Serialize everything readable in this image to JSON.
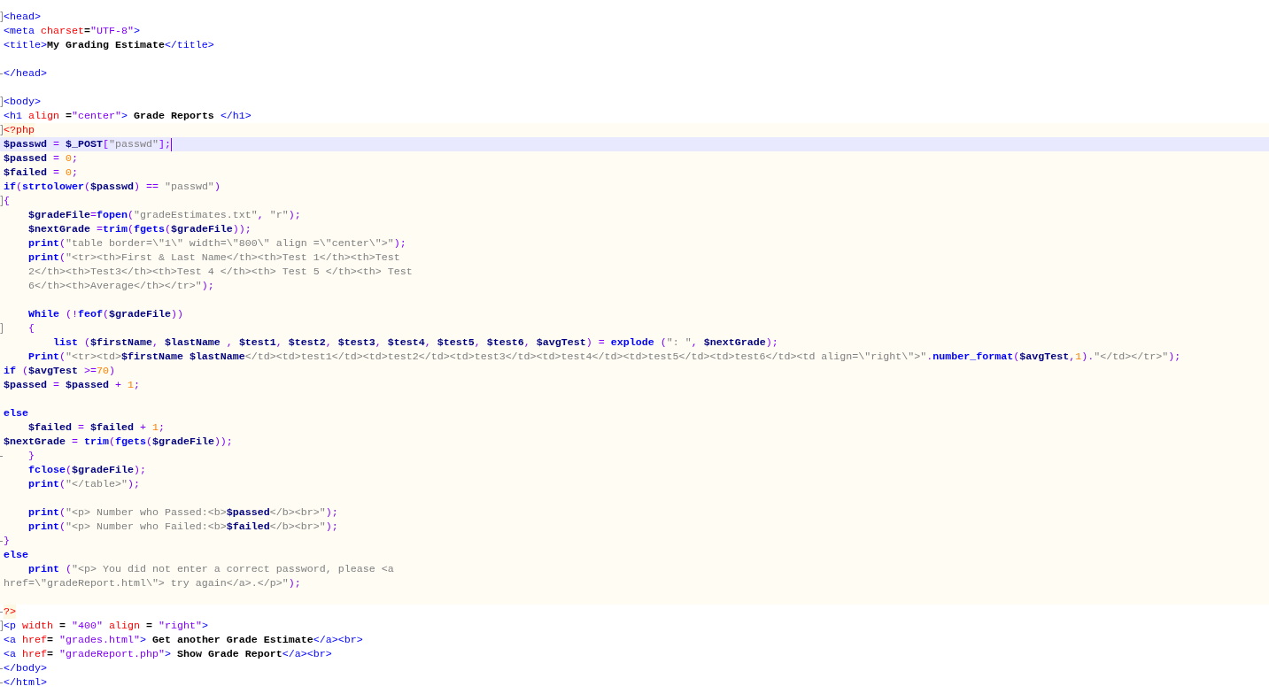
{
  "blocks": [
    {
      "kind": "html",
      "lines": [
        {
          "kind": "opener",
          "current": false,
          "tokens": [
            {
              "kind": "tag",
              "text": "<head>"
            }
          ]
        },
        {
          "kind": "plain",
          "current": false,
          "tokens": [
            {
              "kind": "tag",
              "text": "<meta "
            },
            {
              "kind": "attr",
              "text": "charset"
            },
            {
              "kind": "text",
              "text": "="
            },
            {
              "kind": "val",
              "text": "\"UTF-8\""
            },
            {
              "kind": "tag",
              "text": ">"
            }
          ]
        },
        {
          "kind": "plain",
          "current": false,
          "tokens": [
            {
              "kind": "tag",
              "text": "<title>"
            },
            {
              "kind": "text",
              "text": "My Grading Estimate"
            },
            {
              "kind": "tag",
              "text": "</title>"
            }
          ]
        },
        {
          "kind": "plain"
        },
        {
          "kind": "closer",
          "current": false,
          "tokens": [
            {
              "kind": "tag",
              "text": "</head>"
            }
          ]
        },
        {
          "kind": "plain"
        },
        {
          "kind": "opener",
          "current": false,
          "tokens": [
            {
              "kind": "tag",
              "text": "<body>"
            }
          ]
        },
        {
          "kind": "plain",
          "current": false,
          "tokens": [
            {
              "kind": "tag",
              "text": "<h1 "
            },
            {
              "kind": "attr",
              "text": "align"
            },
            {
              "kind": "text",
              "text": " ="
            },
            {
              "kind": "val",
              "text": "\"center\""
            },
            {
              "kind": "tag",
              "text": ">"
            },
            {
              "kind": "text",
              "text": " Grade Reports "
            },
            {
              "kind": "tag",
              "text": "</h1>"
            }
          ]
        }
      ]
    },
    {
      "kind": "php",
      "lines": [
        {
          "kind": "opener",
          "current": false,
          "tokens": [
            {
              "kind": "delim",
              "text": "<?php"
            }
          ]
        },
        {
          "kind": "plain",
          "current": true,
          "tokens": [
            {
              "kind": "var",
              "text": "$passwd"
            },
            {
              "kind": "op",
              "text": " = "
            },
            {
              "kind": "var",
              "text": "$_POST"
            },
            {
              "kind": "op",
              "text": "["
            },
            {
              "kind": "str",
              "text": "\"passwd\""
            },
            {
              "kind": "op",
              "text": "];"
            }
          ]
        },
        {
          "kind": "plain",
          "current": false,
          "tokens": [
            {
              "kind": "var",
              "text": "$passed"
            },
            {
              "kind": "op",
              "text": " = "
            },
            {
              "kind": "num",
              "text": "0"
            },
            {
              "kind": "op",
              "text": ";"
            }
          ]
        },
        {
          "kind": "plain",
          "current": false,
          "tokens": [
            {
              "kind": "var",
              "text": "$failed"
            },
            {
              "kind": "op",
              "text": " = "
            },
            {
              "kind": "num",
              "text": "0"
            },
            {
              "kind": "op",
              "text": ";"
            }
          ]
        },
        {
          "kind": "plain",
          "current": false,
          "tokens": [
            {
              "kind": "kw",
              "text": "if"
            },
            {
              "kind": "op",
              "text": "("
            },
            {
              "kind": "kw",
              "text": "strtolower"
            },
            {
              "kind": "op",
              "text": "("
            },
            {
              "kind": "var",
              "text": "$passwd"
            },
            {
              "kind": "op",
              "text": ") == "
            },
            {
              "kind": "str",
              "text": "\"passwd\""
            },
            {
              "kind": "op",
              "text": ")"
            }
          ]
        },
        {
          "kind": "opener",
          "current": false,
          "tokens": [
            {
              "kind": "op",
              "text": "{"
            }
          ]
        },
        {
          "kind": "plain",
          "current": false,
          "tokens": [
            {
              "kind": "var",
              "text": "    $gradeFile"
            },
            {
              "kind": "op",
              "text": "="
            },
            {
              "kind": "kw",
              "text": "fopen"
            },
            {
              "kind": "op",
              "text": "("
            },
            {
              "kind": "str",
              "text": "\"gradeEstimates.txt\""
            },
            {
              "kind": "op",
              "text": ", "
            },
            {
              "kind": "str",
              "text": "\"r\""
            },
            {
              "kind": "op",
              "text": ");"
            }
          ]
        },
        {
          "kind": "plain",
          "current": false,
          "tokens": [
            {
              "kind": "var",
              "text": "    $nextGrade"
            },
            {
              "kind": "op",
              "text": " ="
            },
            {
              "kind": "kw",
              "text": "trim"
            },
            {
              "kind": "op",
              "text": "("
            },
            {
              "kind": "kw",
              "text": "fgets"
            },
            {
              "kind": "op",
              "text": "("
            },
            {
              "kind": "var",
              "text": "$gradeFile"
            },
            {
              "kind": "op",
              "text": "));"
            }
          ]
        },
        {
          "kind": "plain",
          "current": false,
          "tokens": [
            {
              "kind": "kw",
              "text": "    print"
            },
            {
              "kind": "op",
              "text": "("
            },
            {
              "kind": "str",
              "text": "\"table border=\\\"1\\\" width=\\\"800\\\" align =\\\"center\\\">\""
            },
            {
              "kind": "op",
              "text": ");"
            }
          ]
        },
        {
          "kind": "plain",
          "current": false,
          "tokens": [
            {
              "kind": "kw",
              "text": "    print"
            },
            {
              "kind": "op",
              "text": "("
            },
            {
              "kind": "str",
              "text": "\"<tr><th>First & Last Name</th><th>Test 1</th><th>Test"
            }
          ]
        },
        {
          "kind": "plain",
          "current": false,
          "tokens": [
            {
              "kind": "str",
              "text": "    2</th><th>Test3</th><th>Test 4 </th><th> Test 5 </th><th> Test"
            }
          ]
        },
        {
          "kind": "plain",
          "current": false,
          "tokens": [
            {
              "kind": "str",
              "text": "    6</th><th>Average</th></tr>\""
            },
            {
              "kind": "op",
              "text": ");"
            }
          ]
        },
        {
          "kind": "plain"
        },
        {
          "kind": "plain",
          "current": false,
          "tokens": [
            {
              "kind": "kw",
              "text": "    While"
            },
            {
              "kind": "op",
              "text": " (!"
            },
            {
              "kind": "kw",
              "text": "feof"
            },
            {
              "kind": "op",
              "text": "("
            },
            {
              "kind": "var",
              "text": "$gradeFile"
            },
            {
              "kind": "op",
              "text": "))"
            }
          ]
        },
        {
          "kind": "opener",
          "current": false,
          "tokens": [
            {
              "kind": "op",
              "text": "    {"
            }
          ]
        },
        {
          "kind": "plain",
          "current": false,
          "tokens": [
            {
              "kind": "kw",
              "text": "        list"
            },
            {
              "kind": "op",
              "text": " ("
            },
            {
              "kind": "var",
              "text": "$firstName"
            },
            {
              "kind": "op",
              "text": ", "
            },
            {
              "kind": "var",
              "text": "$lastName"
            },
            {
              "kind": "op",
              "text": " , "
            },
            {
              "kind": "var",
              "text": "$test1"
            },
            {
              "kind": "op",
              "text": ", "
            },
            {
              "kind": "var",
              "text": "$test2"
            },
            {
              "kind": "op",
              "text": ", "
            },
            {
              "kind": "var",
              "text": "$test3"
            },
            {
              "kind": "op",
              "text": ", "
            },
            {
              "kind": "var",
              "text": "$test4"
            },
            {
              "kind": "op",
              "text": ", "
            },
            {
              "kind": "var",
              "text": "$test5"
            },
            {
              "kind": "op",
              "text": ", "
            },
            {
              "kind": "var",
              "text": "$test6"
            },
            {
              "kind": "op",
              "text": ", "
            },
            {
              "kind": "var",
              "text": "$avgTest"
            },
            {
              "kind": "op",
              "text": ") = "
            },
            {
              "kind": "kw",
              "text": "explode"
            },
            {
              "kind": "op",
              "text": " ("
            },
            {
              "kind": "str",
              "text": "\": \""
            },
            {
              "kind": "op",
              "text": ", "
            },
            {
              "kind": "var",
              "text": "$nextGrade"
            },
            {
              "kind": "op",
              "text": ");"
            }
          ]
        },
        {
          "kind": "plain",
          "current": false,
          "tokens": [
            {
              "kind": "kw",
              "text": "    Print"
            },
            {
              "kind": "op",
              "text": "("
            },
            {
              "kind": "str",
              "text": "\"<tr><td>"
            },
            {
              "kind": "var",
              "text": "$firstName $lastName"
            },
            {
              "kind": "str",
              "text": "</td><td>test1</td><td>test2</td><td>test3</td><td>test4</td><td>test5</td><td>test6</td><td align=\\\"right\\\">\""
            },
            {
              "kind": "op",
              "text": "."
            },
            {
              "kind": "kw",
              "text": "number_format"
            },
            {
              "kind": "op",
              "text": "("
            },
            {
              "kind": "var",
              "text": "$avgTest"
            },
            {
              "kind": "op",
              "text": ","
            },
            {
              "kind": "num",
              "text": "1"
            },
            {
              "kind": "op",
              "text": ")."
            },
            {
              "kind": "str",
              "text": "\"</td></tr>\""
            },
            {
              "kind": "op",
              "text": ");"
            }
          ]
        },
        {
          "kind": "plain",
          "current": false,
          "tokens": [
            {
              "kind": "kw",
              "text": "if"
            },
            {
              "kind": "op",
              "text": " ("
            },
            {
              "kind": "var",
              "text": "$avgTest"
            },
            {
              "kind": "op",
              "text": " >="
            },
            {
              "kind": "num",
              "text": "70"
            },
            {
              "kind": "op",
              "text": ")"
            }
          ]
        },
        {
          "kind": "plain",
          "current": false,
          "tokens": [
            {
              "kind": "var",
              "text": "$passed"
            },
            {
              "kind": "op",
              "text": " = "
            },
            {
              "kind": "var",
              "text": "$passed"
            },
            {
              "kind": "op",
              "text": " + "
            },
            {
              "kind": "num",
              "text": "1"
            },
            {
              "kind": "op",
              "text": ";"
            }
          ]
        },
        {
          "kind": "plain"
        },
        {
          "kind": "plain",
          "current": false,
          "tokens": [
            {
              "kind": "kw",
              "text": "else"
            }
          ]
        },
        {
          "kind": "plain",
          "current": false,
          "tokens": [
            {
              "kind": "var",
              "text": "    $failed"
            },
            {
              "kind": "op",
              "text": " = "
            },
            {
              "kind": "var",
              "text": "$failed"
            },
            {
              "kind": "op",
              "text": " + "
            },
            {
              "kind": "num",
              "text": "1"
            },
            {
              "kind": "op",
              "text": ";"
            }
          ]
        },
        {
          "kind": "plain",
          "current": false,
          "tokens": [
            {
              "kind": "var",
              "text": "$nextGrade"
            },
            {
              "kind": "op",
              "text": " = "
            },
            {
              "kind": "kw",
              "text": "trim"
            },
            {
              "kind": "op",
              "text": "("
            },
            {
              "kind": "kw",
              "text": "fgets"
            },
            {
              "kind": "op",
              "text": "("
            },
            {
              "kind": "var",
              "text": "$gradeFile"
            },
            {
              "kind": "op",
              "text": "));"
            }
          ]
        },
        {
          "kind": "closer",
          "current": false,
          "tokens": [
            {
              "kind": "op",
              "text": "    }"
            }
          ]
        },
        {
          "kind": "plain",
          "current": false,
          "tokens": [
            {
              "kind": "kw",
              "text": "    fclose"
            },
            {
              "kind": "op",
              "text": "("
            },
            {
              "kind": "var",
              "text": "$gradeFile"
            },
            {
              "kind": "op",
              "text": ");"
            }
          ]
        },
        {
          "kind": "plain",
          "current": false,
          "tokens": [
            {
              "kind": "kw",
              "text": "    print"
            },
            {
              "kind": "op",
              "text": "("
            },
            {
              "kind": "str",
              "text": "\"</table>\""
            },
            {
              "kind": "op",
              "text": ");"
            }
          ]
        },
        {
          "kind": "plain"
        },
        {
          "kind": "plain",
          "current": false,
          "tokens": [
            {
              "kind": "kw",
              "text": "    print"
            },
            {
              "kind": "op",
              "text": "("
            },
            {
              "kind": "str",
              "text": "\"<p> Number who Passed:<b>"
            },
            {
              "kind": "var",
              "text": "$passed"
            },
            {
              "kind": "str",
              "text": "</b><br>\""
            },
            {
              "kind": "op",
              "text": ");"
            }
          ]
        },
        {
          "kind": "plain",
          "current": false,
          "tokens": [
            {
              "kind": "kw",
              "text": "    print"
            },
            {
              "kind": "op",
              "text": "("
            },
            {
              "kind": "str",
              "text": "\"<p> Number who Failed:<b>"
            },
            {
              "kind": "var",
              "text": "$failed"
            },
            {
              "kind": "str",
              "text": "</b><br>\""
            },
            {
              "kind": "op",
              "text": ");"
            }
          ]
        },
        {
          "kind": "closer",
          "current": false,
          "tokens": [
            {
              "kind": "op",
              "text": "}"
            }
          ]
        },
        {
          "kind": "plain",
          "current": false,
          "tokens": [
            {
              "kind": "kw",
              "text": "else"
            }
          ]
        },
        {
          "kind": "plain",
          "current": false,
          "tokens": [
            {
              "kind": "kw",
              "text": "    print"
            },
            {
              "kind": "op",
              "text": " ("
            },
            {
              "kind": "str",
              "text": "\"<p> You did not enter a correct password, please <a"
            }
          ]
        },
        {
          "kind": "plain",
          "current": false,
          "tokens": [
            {
              "kind": "str",
              "text": "href=\\\"gradeReport.html\\\"> try again</a>.</p>\""
            },
            {
              "kind": "op",
              "text": ");"
            }
          ]
        },
        {
          "kind": "plain"
        }
      ]
    },
    {
      "kind": "html",
      "lines": [
        {
          "kind": "closer",
          "current": false,
          "tokens": [
            {
              "kind": "delim",
              "text": "?>"
            }
          ]
        },
        {
          "kind": "opener",
          "current": false,
          "tokens": [
            {
              "kind": "tag",
              "text": "<p "
            },
            {
              "kind": "attr",
              "text": "width"
            },
            {
              "kind": "text",
              "text": " = "
            },
            {
              "kind": "val",
              "text": "\"400\""
            },
            {
              "kind": "attr",
              "text": " align"
            },
            {
              "kind": "text",
              "text": " = "
            },
            {
              "kind": "val",
              "text": "\"right\""
            },
            {
              "kind": "tag",
              "text": ">"
            }
          ]
        },
        {
          "kind": "plain",
          "current": false,
          "tokens": [
            {
              "kind": "tag",
              "text": "<a "
            },
            {
              "kind": "attr",
              "text": "href"
            },
            {
              "kind": "text",
              "text": "= "
            },
            {
              "kind": "val",
              "text": "\"grades.html\""
            },
            {
              "kind": "tag",
              "text": ">"
            },
            {
              "kind": "text",
              "text": " Get another Grade Estimate"
            },
            {
              "kind": "tag",
              "text": "</a><br>"
            }
          ]
        },
        {
          "kind": "plain",
          "current": false,
          "tokens": [
            {
              "kind": "tag",
              "text": "<a "
            },
            {
              "kind": "attr",
              "text": "href"
            },
            {
              "kind": "text",
              "text": "= "
            },
            {
              "kind": "val",
              "text": "\"gradeReport.php\""
            },
            {
              "kind": "tag",
              "text": ">"
            },
            {
              "kind": "text",
              "text": " Show Grade Report"
            },
            {
              "kind": "tag",
              "text": "</a><br>"
            }
          ]
        },
        {
          "kind": "closer",
          "current": false,
          "tokens": [
            {
              "kind": "tag",
              "text": "</body>"
            }
          ]
        },
        {
          "kind": "closer",
          "current": false,
          "tokens": [
            {
              "kind": "tag",
              "text": "</html>"
            }
          ]
        }
      ]
    }
  ]
}
